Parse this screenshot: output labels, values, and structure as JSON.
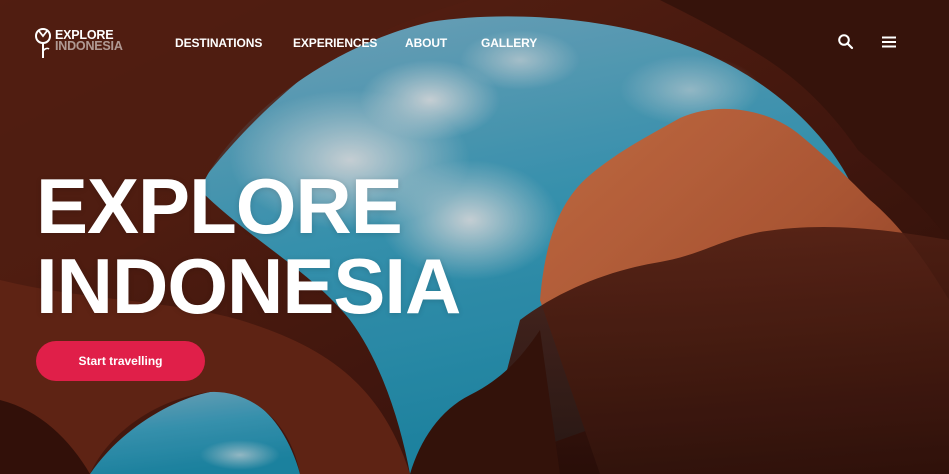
{
  "brand": {
    "line1": "EXPLORE",
    "line2": "INDONESIA"
  },
  "nav": {
    "items": [
      {
        "label": "DESTINATIONS"
      },
      {
        "label": "EXPERIENCES"
      },
      {
        "label": "ABOUT"
      },
      {
        "label": "GALLERY"
      }
    ],
    "icons": [
      "search-icon",
      "menu-icon"
    ]
  },
  "hero": {
    "title_line1": "EXPLORE",
    "title_line2": "INDONESIA",
    "cta_label": "Start travelling"
  },
  "colors": {
    "accent": "#e01f49",
    "sky": "#3fa6c2",
    "rock_dark": "#4a1c12",
    "rock_lit": "#c0623c",
    "text": "#ffffff"
  }
}
